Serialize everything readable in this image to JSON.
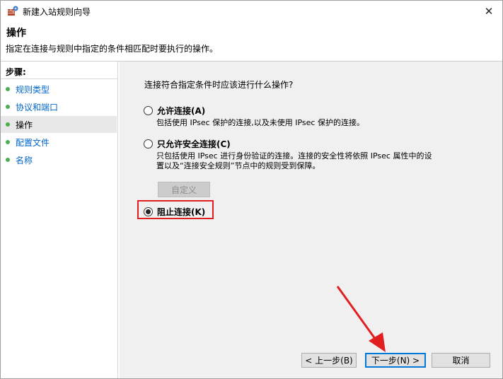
{
  "window": {
    "title": "新建入站规则向导",
    "close_glyph": "✕"
  },
  "header": {
    "title": "操作",
    "subtitle": "指定在连接与规则中指定的条件相匹配时要执行的操作。"
  },
  "sidebar": {
    "title": "步骤:",
    "items": [
      {
        "label": "规则类型",
        "active": false
      },
      {
        "label": "协议和端口",
        "active": false
      },
      {
        "label": "操作",
        "active": true
      },
      {
        "label": "配置文件",
        "active": false
      },
      {
        "label": "名称",
        "active": false
      }
    ]
  },
  "main": {
    "question": "连接符合指定条件时应该进行什么操作?",
    "options": [
      {
        "label": "允许连接(A)",
        "checked": false,
        "description": "包括使用 IPsec 保护的连接,以及未使用 IPsec 保护的连接。"
      },
      {
        "label": "只允许安全连接(C)",
        "checked": false,
        "description_line1": "只包括使用 IPsec 进行身份验证的连接。连接的安全性将依照 IPsec 属性中的设",
        "description_line2": "置以及“连接安全规则”节点中的规则受到保障。"
      },
      {
        "label": "阻止连接(K)",
        "checked": true
      }
    ],
    "customize_label": "自定义"
  },
  "footer": {
    "back": "< 上一步(B)",
    "next": "下一步(N) >",
    "cancel": "取消"
  },
  "colors": {
    "annotation": "#e02020",
    "step_bullet": "#4caf50",
    "step_link": "#0066cc",
    "content_bg": "#f0f0f0"
  },
  "icons": {
    "title": "firewall-wizard-icon"
  }
}
